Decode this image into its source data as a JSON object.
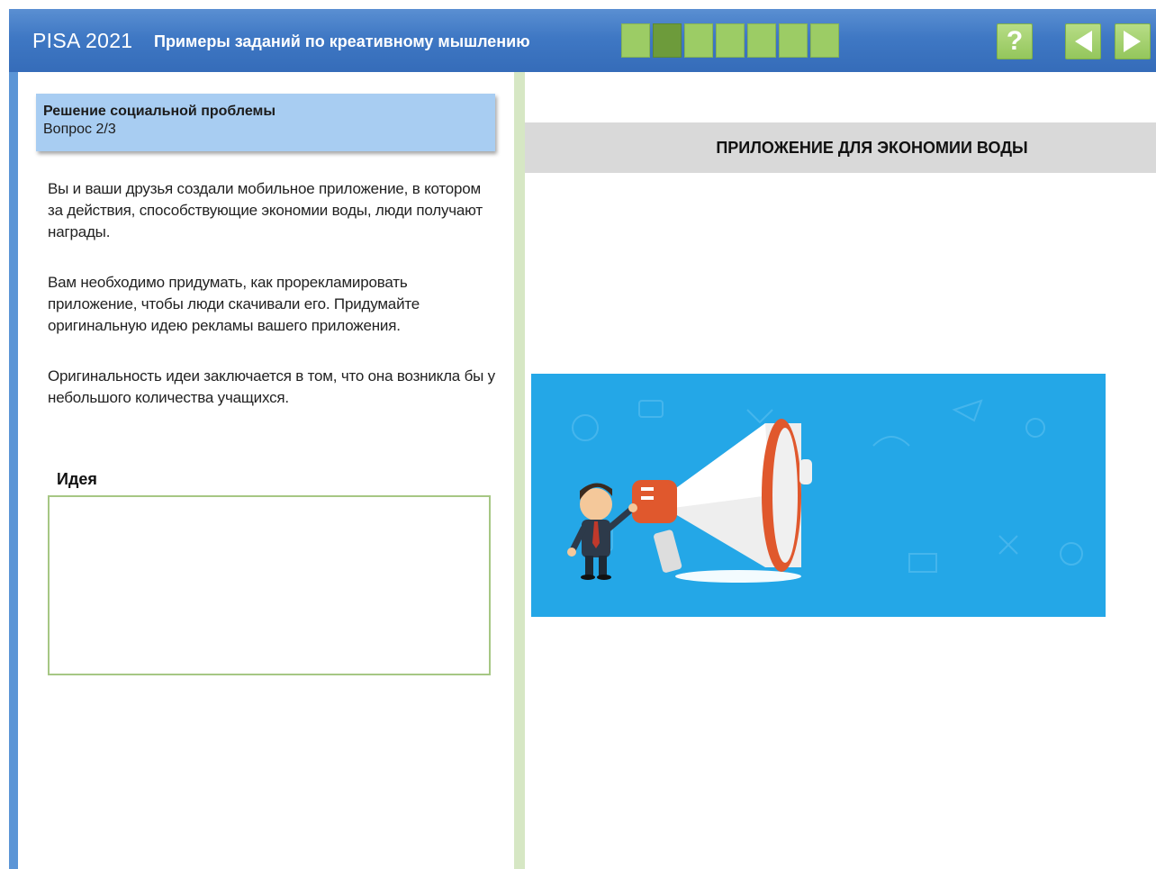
{
  "header": {
    "brand": "PISA 2021",
    "subtitle": "Примеры заданий по креативному мышлению",
    "progress": {
      "total_steps": 7,
      "current_step": 2
    },
    "buttons": {
      "help_label": "?",
      "help_icon": "help-icon",
      "prev_icon": "arrow-left-icon",
      "next_icon": "arrow-right-icon"
    }
  },
  "task": {
    "title": "Решение социальной проблемы",
    "question": "Вопрос 2/3",
    "paragraphs": [
      "Вы и ваши друзья создали мобильное приложение, в котором за действия, способствующие экономии воды, люди получают награды.",
      "Вам необходимо придумать, как прорекламировать приложение, чтобы люди скачивали его. Придумайте оригинальную идею рекламы вашего приложения.",
      "Оригинальность идеи заключается в том, что она возникла бы у небольшого количества учащихся."
    ],
    "idea_label": "Идея",
    "idea_value": ""
  },
  "right": {
    "title": "ПРИЛОЖЕНИЕ ДЛЯ ЭКОНОМИИ ВОДЫ",
    "image": "megaphone-illustration"
  },
  "colors": {
    "header_blue": "#3f78c4",
    "progress_green": "#9ccc65",
    "progress_active": "#6d9b3b",
    "task_header_bg": "#a8cdf2",
    "image_bg": "#24a7e7",
    "idea_border": "#a6c784"
  }
}
